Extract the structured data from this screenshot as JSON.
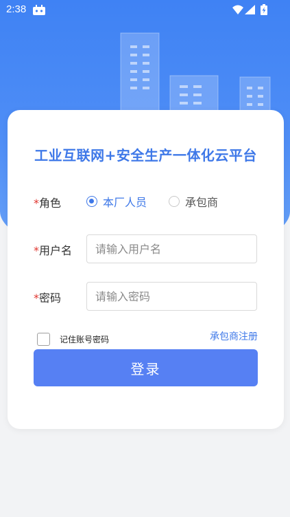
{
  "status_bar": {
    "time": "2:38",
    "app_icon": "android-robot-icon",
    "wifi_icon": "wifi-icon",
    "signal_icon": "cell-signal-icon",
    "battery_icon": "battery-charging-icon"
  },
  "hero": {
    "illustration": "city-buildings-icon",
    "color": "#3f82f4"
  },
  "login": {
    "title": "工业互联网+安全生产一体化云平台",
    "role_label": "角色",
    "required_mark": "*",
    "roles": [
      {
        "label": "本厂人员",
        "selected": true
      },
      {
        "label": "承包商",
        "selected": false
      }
    ],
    "username_label": "用户名",
    "username_placeholder": "请输入用户名",
    "password_label": "密码",
    "password_placeholder": "请输入密码",
    "remember_label": "记住账号密码",
    "remember_checked": false,
    "register_link": "承包商注册",
    "submit_label": "登录"
  },
  "colors": {
    "accent": "#3e78e8",
    "button": "#5680f3",
    "required": "#e0362f",
    "background": "#f2f3f5"
  }
}
